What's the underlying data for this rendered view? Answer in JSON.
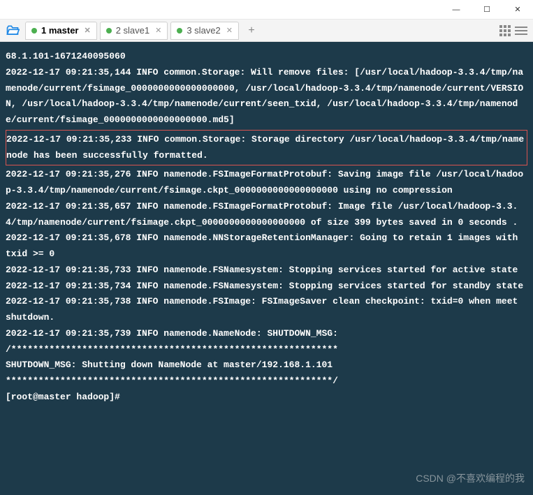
{
  "window": {
    "minimize": "—",
    "maximize": "☐",
    "close": "✕"
  },
  "tabs": [
    {
      "label": "1 master",
      "active": true
    },
    {
      "label": "2 slave1",
      "active": false
    },
    {
      "label": "3 slave2",
      "active": false
    }
  ],
  "addTab": "+",
  "terminal": {
    "lines": [
      "68.1.101-1671240095060",
      "2022-12-17 09:21:35,144 INFO common.Storage: Will remove files: [/usr/local/hadoop-3.3.4/tmp/namenode/current/fsimage_0000000000000000000, /usr/local/hadoop-3.3.4/tmp/namenode/current/VERSION, /usr/local/hadoop-3.3.4/tmp/namenode/current/seen_txid, /usr/local/hadoop-3.3.4/tmp/namenode/current/fsimage_0000000000000000000.md5]"
    ],
    "highlighted": "2022-12-17 09:21:35,233 INFO common.Storage: Storage directory /usr/local/hadoop-3.3.4/tmp/namenode has been successfully formatted.",
    "lines2": [
      "2022-12-17 09:21:35,276 INFO namenode.FSImageFormatProtobuf: Saving image file /usr/local/hadoop-3.3.4/tmp/namenode/current/fsimage.ckpt_0000000000000000000 using no compression",
      "2022-12-17 09:21:35,657 INFO namenode.FSImageFormatProtobuf: Image file /usr/local/hadoop-3.3.4/tmp/namenode/current/fsimage.ckpt_0000000000000000000 of size 399 bytes saved in 0 seconds .",
      "2022-12-17 09:21:35,678 INFO namenode.NNStorageRetentionManager: Going to retain 1 images with txid >= 0",
      "2022-12-17 09:21:35,733 INFO namenode.FSNamesystem: Stopping services started for active state",
      "2022-12-17 09:21:35,734 INFO namenode.FSNamesystem: Stopping services started for standby state",
      "2022-12-17 09:21:35,738 INFO namenode.FSImage: FSImageSaver clean checkpoint: txid=0 when meet shutdown.",
      "2022-12-17 09:21:35,739 INFO namenode.NameNode: SHUTDOWN_MSG:",
      "/************************************************************",
      "SHUTDOWN_MSG: Shutting down NameNode at master/192.168.1.101",
      "************************************************************/",
      "[root@master hadoop]#"
    ]
  },
  "watermark": "CSDN @不喜欢编程的我"
}
